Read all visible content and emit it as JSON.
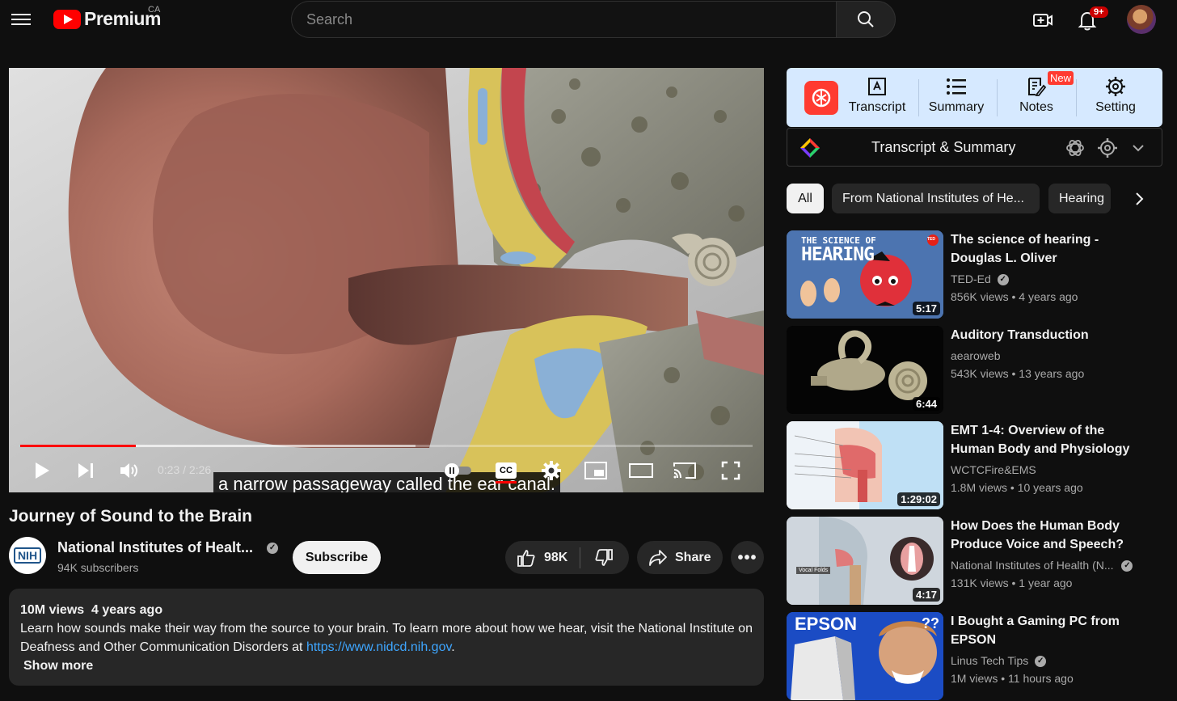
{
  "header": {
    "logo_text": "Premium",
    "region": "CA",
    "search_placeholder": "Search",
    "notifications_badge": "9+"
  },
  "player": {
    "caption": "a narrow passageway called the ear canal.",
    "current_time": "0:23",
    "duration": "2:26",
    "time_display": "0:23 / 2:26",
    "progress_fraction": 0.158,
    "buffered_fraction": 0.54,
    "cc_label": "CC"
  },
  "video": {
    "title": "Journey of Sound to the Brain",
    "channel_name": "National Institutes of Healt...",
    "channel_avatar_text": "NIH",
    "subscribers": "94K subscribers",
    "subscribe_label": "Subscribe",
    "likes": "98K",
    "share_label": "Share",
    "stats": "10M views  4 years ago",
    "description_text": "Learn how sounds make their way from the source to your brain. To learn more about how we hear, visit the National Institute on Deafness and Other Communication Disorders at ",
    "description_link": "https://www.nidcd.nih.gov",
    "description_end": ".",
    "show_more": "Show more"
  },
  "extension": {
    "tabs": [
      {
        "label": "Transcript",
        "icon": "transcript-icon"
      },
      {
        "label": "Summary",
        "icon": "list-icon"
      },
      {
        "label": "Notes",
        "icon": "notes-icon"
      },
      {
        "label": "Setting",
        "icon": "gear-icon"
      }
    ],
    "new_badge": "New",
    "panel_title": "Transcript & Summary",
    "accent": "#ff3b30",
    "bar_bg": "#d6e9ff"
  },
  "chips": [
    "All",
    "From National Institutes of He...",
    "Hearing"
  ],
  "recommendations": [
    {
      "title": "The science of hearing - Douglas L. Oliver",
      "channel": "TED-Ed",
      "verified": true,
      "views": "856K views",
      "age": "4 years ago",
      "duration": "5:17",
      "thumb_text_small": "THE SCIENCE OF",
      "thumb_text_big": "HEARING",
      "thumb_badge": "TED"
    },
    {
      "title": "Auditory Transduction",
      "channel": "aearoweb",
      "verified": false,
      "views": "543K views",
      "age": "13 years ago",
      "duration": "6:44"
    },
    {
      "title": "EMT 1-4: Overview of the Human Body and Physiology",
      "channel": "WCTCFire&EMS",
      "verified": false,
      "views": "1.8M views",
      "age": "10 years ago",
      "duration": "1:29:02"
    },
    {
      "title": "How Does the Human Body Produce Voice and Speech?",
      "channel": "National Institutes of Health (N...",
      "verified": true,
      "views": "131K views",
      "age": "1 year ago",
      "duration": "4:17",
      "thumb_label": "Vocal Folds"
    },
    {
      "title": "I Bought a Gaming PC from EPSON",
      "channel": "Linus Tech Tips",
      "verified": true,
      "views": "1M views",
      "age": "11 hours ago",
      "thumb_text": "EPSON",
      "thumb_q": "??"
    }
  ],
  "colors": {
    "brand_red": "#ff0000",
    "progress_red": "#ff0000",
    "link_blue": "#3ea6ff",
    "background": "#0f0f0f"
  }
}
